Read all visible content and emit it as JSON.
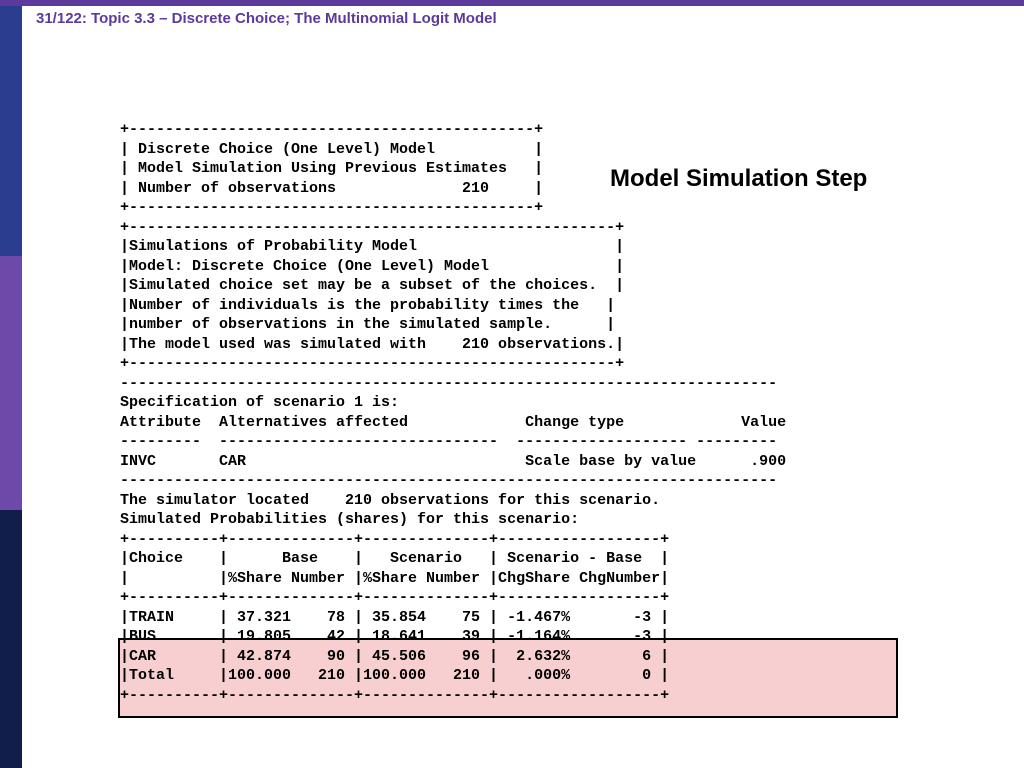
{
  "header": "31/122: Topic 3.3 – Discrete Choice; The Multinomial Logit Model",
  "step_title": "Model Simulation Step",
  "output_text": "+---------------------------------------------+\n| Discrete Choice (One Level) Model           |\n| Model Simulation Using Previous Estimates   |\n| Number of observations              210     |\n+---------------------------------------------+\n+------------------------------------------------------+\n|Simulations of Probability Model                      |\n|Model: Discrete Choice (One Level) Model              |\n|Simulated choice set may be a subset of the choices.  |\n|Number of individuals is the probability times the   |\n|number of observations in the simulated sample.      |\n|The model used was simulated with    210 observations.|\n+------------------------------------------------------+\n-------------------------------------------------------------------------\nSpecification of scenario 1 is:\nAttribute  Alternatives affected             Change type             Value\n---------  -------------------------------  ------------------- ---------\nINVC       CAR                               Scale base by value      .900\n-------------------------------------------------------------------------\nThe simulator located    210 observations for this scenario.\nSimulated Probabilities (shares) for this scenario:\n+----------+--------------+--------------+------------------+\n|Choice    |      Base    |   Scenario   | Scenario - Base  |\n|          |%Share Number |%Share Number |ChgShare ChgNumber|\n+----------+--------------+--------------+------------------+\n|TRAIN     | 37.321    78 | 35.854    75 | -1.467%       -3 |\n|BUS       | 19.805    42 | 18.641    39 | -1.164%       -3 |\n|CAR       | 42.874    90 | 45.506    96 |  2.632%        6 |\n|Total     |100.000   210 |100.000   210 |   .000%        0 |\n+----------+--------------+--------------+------------------+",
  "chart_data": {
    "type": "table",
    "title": "Simulated Probabilities (shares) for this scenario",
    "columns": [
      "Choice",
      "Base %Share",
      "Base Number",
      "Scenario %Share",
      "Scenario Number",
      "ChgShare",
      "ChgNumber"
    ],
    "rows": [
      {
        "choice": "TRAIN",
        "base_share": 37.321,
        "base_num": 78,
        "scen_share": 35.854,
        "scen_num": 75,
        "chg_share": "-1.467%",
        "chg_num": -3
      },
      {
        "choice": "BUS",
        "base_share": 19.805,
        "base_num": 42,
        "scen_share": 18.641,
        "scen_num": 39,
        "chg_share": "-1.164%",
        "chg_num": -3
      },
      {
        "choice": "CAR",
        "base_share": 42.874,
        "base_num": 90,
        "scen_share": 45.506,
        "scen_num": 96,
        "chg_share": "2.632%",
        "chg_num": 6
      },
      {
        "choice": "Total",
        "base_share": 100.0,
        "base_num": 210,
        "scen_share": 100.0,
        "scen_num": 210,
        "chg_share": ".000%",
        "chg_num": 0
      }
    ],
    "scenario": {
      "attribute": "INVC",
      "alternatives_affected": "CAR",
      "change_type": "Scale base by value",
      "value": 0.9,
      "observations": 210
    }
  }
}
